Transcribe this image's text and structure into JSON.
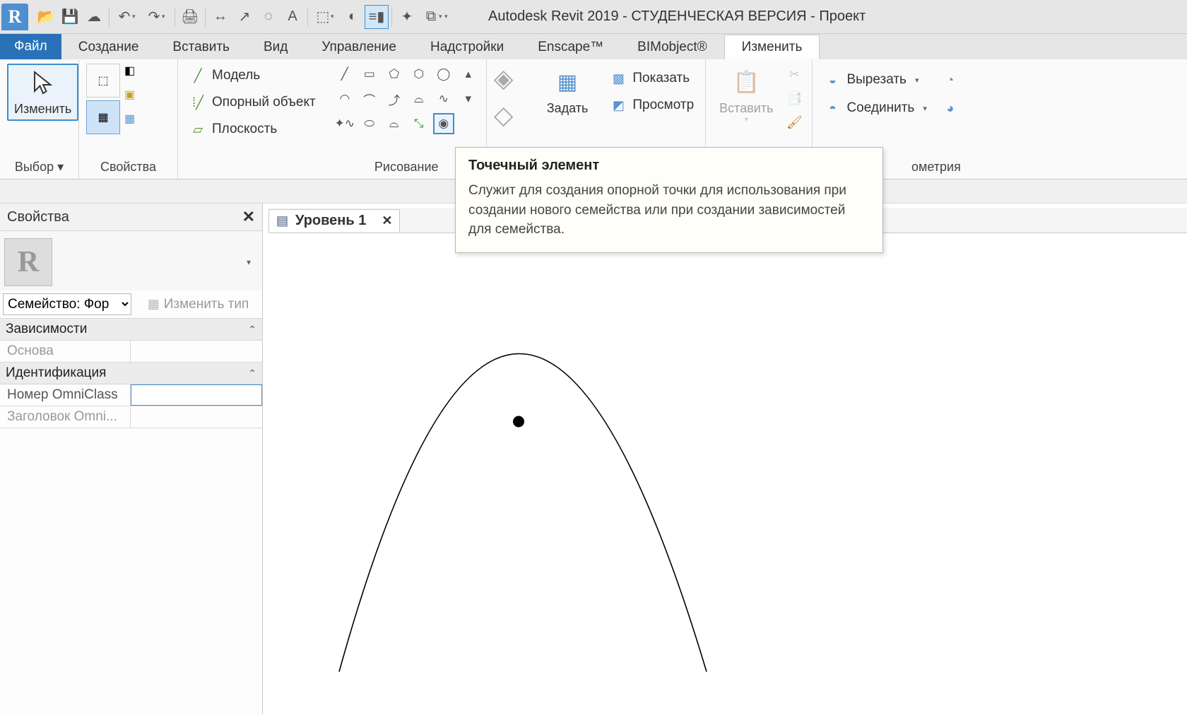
{
  "app_title": "Autodesk Revit 2019 - СТУДЕНЧЕСКАЯ ВЕРСИЯ - Проект",
  "logo_letter": "R",
  "tabs": {
    "file": "Файл",
    "create": "Создание",
    "insert": "Вставить",
    "view": "Вид",
    "manage": "Управление",
    "addins": "Надстройки",
    "enscape": "Enscape™",
    "bimobject": "BIMobject®",
    "modify": "Изменить"
  },
  "ribbon": {
    "select_panel": "Выбор",
    "modify_btn": "Изменить",
    "properties_panel": "Свойства",
    "model_btn": "Модель",
    "ref_object_btn": "Опорный объект",
    "plane_btn": "Плоскость",
    "draw_panel": "Рисование",
    "set_btn": "Задать",
    "show_btn": "Показать",
    "viewer_btn": "Просмотр",
    "paste_btn": "Вставить",
    "cut_btn": "Вырезать",
    "join_btn": "Соединить",
    "geometry_panel": "ометрия"
  },
  "tooltip": {
    "title": "Точечный элемент",
    "body": "Служит для создания опорной точки для использования при создании нового семейства или при создании зависимостей для семейства."
  },
  "properties": {
    "panel_title": "Свойства",
    "family_selector": "Семейство: Фор",
    "edit_type": "Изменить тип",
    "group_constraints": "Зависимости",
    "row_base": "Основа",
    "group_identity": "Идентификация",
    "row_omniclass_num": "Номер OmniClass",
    "row_omniclass_title": "Заголовок Omni..."
  },
  "view": {
    "level_name": "Уровень 1"
  }
}
